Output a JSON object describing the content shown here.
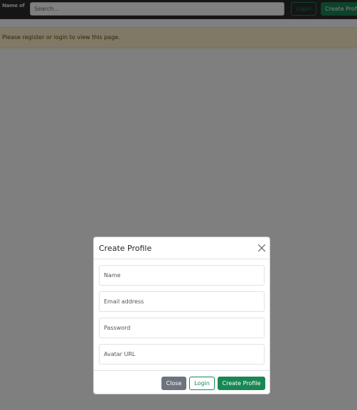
{
  "navbar": {
    "brand": "Name of",
    "search_placeholder": "Search...",
    "login_label": "Login",
    "create_profile_label": "Create Profile"
  },
  "alert": {
    "message": "Please register or login to view this page."
  },
  "modal": {
    "title": "Create Profile",
    "fields": {
      "name_placeholder": "Name",
      "email_placeholder": "Email address",
      "password_placeholder": "Password",
      "avatar_placeholder": "Avatar URL"
    },
    "buttons": {
      "close_label": "Close",
      "login_label": "Login",
      "create_label": "Create Profile"
    }
  },
  "colors": {
    "accent": "#198754",
    "secondary": "#6c757d",
    "alert_bg": "#fff3cd",
    "alert_text": "#664d03"
  },
  "icons": {
    "close": "close-icon"
  }
}
